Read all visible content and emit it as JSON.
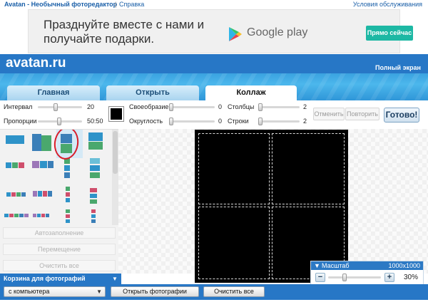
{
  "topbar": {
    "app_name": "Avatan - Необычный фоторедактор",
    "separator": "|",
    "help": "Справка",
    "tos": "Условия обслуживания"
  },
  "ad": {
    "line1": "Празднуйте вместе с нами и",
    "line2": "получайте подарки.",
    "store": "Google play",
    "cta": "Прямо сейчас"
  },
  "header": {
    "logo": "avatan.ru",
    "fullscreen": "Полный экран"
  },
  "tabs": [
    {
      "label": "Главная",
      "active": false
    },
    {
      "label": "Открыть",
      "active": false
    },
    {
      "label": "Коллаж",
      "active": true
    }
  ],
  "controls": {
    "interval": {
      "label": "Интервал",
      "value": "20",
      "level": 0.4
    },
    "proportions": {
      "label": "Пропорции",
      "value": "50:50",
      "level": 0.5
    },
    "peculiarity": {
      "label": "Своеобразие",
      "value": "0",
      "level": 0.0
    },
    "roundness": {
      "label": "Округлость",
      "value": "0",
      "level": 0.0
    },
    "columns": {
      "label": "Столбцы",
      "value": "2",
      "level": 0.0
    },
    "rows": {
      "label": "Строки",
      "value": "2",
      "level": 0.0
    },
    "border_color": "#000000",
    "undo": "Отменить",
    "redo": "Повторить",
    "done": "Готово!"
  },
  "left_panel": {
    "autofill": "Автозаполнение",
    "move": "Перемещение",
    "clear_all": "Очистить все"
  },
  "zoom": {
    "label": "Масштаб",
    "resolution": "1000x1000",
    "minus": "−",
    "plus": "+",
    "percent": "30%",
    "level": 0.3
  },
  "bottom": {
    "basket_title": "Корзина для фотографий",
    "source_select": "с компьютера",
    "open_photos": "Открыть фотографии",
    "clear_all": "Очистить все"
  },
  "colors": {
    "brand_blue": "#2777c6",
    "cta_teal": "#1db8a4",
    "highlight_circle": "#d81d2a"
  }
}
